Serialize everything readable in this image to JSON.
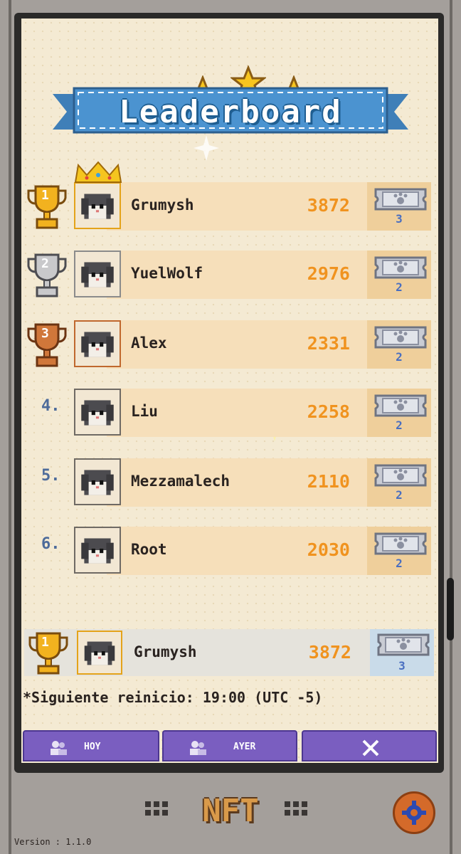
{
  "title": "Leaderboard",
  "colors": {
    "paper": "#f4ead3",
    "row_band": "#f6dfba",
    "score": "#f0931f",
    "rank_number": "#4d6b9a",
    "ribbon": "#4b93d0",
    "tab": "#7a5ec0",
    "ticket_count": "#4a6fc0"
  },
  "leaderboard": [
    {
      "rank": "1",
      "rank_style": "gold-trophy",
      "name": "Grumysh",
      "score": "3872",
      "tickets": "3",
      "crown": true
    },
    {
      "rank": "2",
      "rank_style": "silver-trophy",
      "name": "YuelWolf",
      "score": "2976",
      "tickets": "2"
    },
    {
      "rank": "3",
      "rank_style": "bronze-trophy",
      "name": "Alex",
      "score": "2331",
      "tickets": "2"
    },
    {
      "rank": "4.",
      "rank_style": "number",
      "name": "Liu",
      "score": "2258",
      "tickets": "2"
    },
    {
      "rank": "5.",
      "rank_style": "number",
      "name": "Mezzamalech",
      "score": "2110",
      "tickets": "2"
    },
    {
      "rank": "6.",
      "rank_style": "number",
      "name": "Root",
      "score": "2030",
      "tickets": "2"
    }
  ],
  "current_user": {
    "rank": "1",
    "name": "Grumysh",
    "score": "3872",
    "tickets": "3"
  },
  "reset_note": "*Siguiente reinicio: 19:00 (UTC -5)",
  "tabs": [
    {
      "label": "HOY",
      "icon": "friends-icon"
    },
    {
      "label": "AYER",
      "icon": "friends-icon"
    },
    {
      "label": "",
      "icon": "close-icon"
    }
  ],
  "footer": {
    "logo": "NFT",
    "version": "Version : 1.1.0"
  }
}
